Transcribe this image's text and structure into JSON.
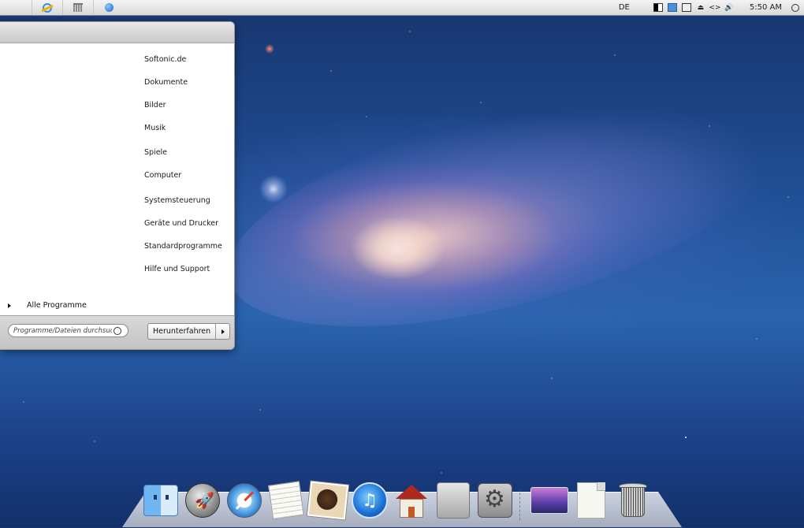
{
  "menubar": {
    "language": "DE",
    "clock": "5:50 AM",
    "tray_icons": [
      "network-icon",
      "windows-icon",
      "display-icon",
      "keyboard-icon",
      "eject-icon",
      "code-icon",
      "speaker-icon"
    ]
  },
  "startmenu": {
    "items": [
      {
        "label": "Softonic.de"
      },
      {
        "label": "Dokumente"
      },
      {
        "label": "Bilder"
      },
      {
        "label": "Musik"
      },
      {
        "label": "Spiele"
      },
      {
        "label": "Computer"
      },
      {
        "label": "Systemsteuerung"
      },
      {
        "label": "Geräte und Drucker"
      },
      {
        "label": "Standardprogramme"
      },
      {
        "label": "Hilfe und Support"
      }
    ],
    "all_programs": "Alle Programme",
    "search_placeholder": "Programme/Dateien durchsuch...",
    "shutdown_label": "Herunterfahren"
  },
  "dock": {
    "icons": [
      "finder-icon",
      "launchpad-icon",
      "safari-icon",
      "textedit-icon",
      "photo-booth-icon",
      "itunes-icon",
      "home-folder-icon",
      "mac-pro-icon",
      "system-preferences-icon",
      "desktop-folder-icon",
      "document-icon",
      "trash-icon"
    ]
  }
}
